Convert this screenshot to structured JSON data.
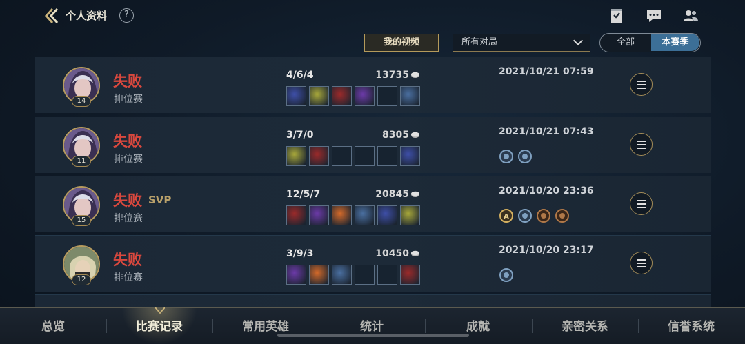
{
  "header": {
    "title": "个人资料",
    "help": "?",
    "icons": [
      "checklist-icon",
      "chat-icon",
      "friends-icon"
    ]
  },
  "filters": {
    "video_button": "我的视频",
    "match_filter": "所有对局",
    "toggle_all": "全部",
    "toggle_season": "本赛季"
  },
  "matches": [
    {
      "level": "14",
      "result": "失败",
      "svp": "",
      "mode": "排位赛",
      "kda": "4/6/4",
      "gold": "13735",
      "date": "2021/10/21 07:59",
      "items": [
        "item",
        "item",
        "item",
        "item",
        "empty",
        "item"
      ],
      "badges": []
    },
    {
      "level": "11",
      "result": "失败",
      "svp": "",
      "mode": "排位赛",
      "kda": "3/7/0",
      "gold": "8305",
      "date": "2021/10/21 07:43",
      "items": [
        "item",
        "item",
        "empty",
        "empty",
        "empty",
        "item"
      ],
      "badges": [
        "badge-blue",
        "badge-blue"
      ]
    },
    {
      "level": "15",
      "result": "失败",
      "svp": "SVP",
      "mode": "排位赛",
      "kda": "12/5/7",
      "gold": "20845",
      "date": "2021/10/20 23:36",
      "items": [
        "item",
        "item",
        "item",
        "item",
        "item",
        "item"
      ],
      "badges": [
        "badge-gold-a",
        "badge-blue",
        "badge-bronze",
        "badge-bronze"
      ]
    },
    {
      "level": "12",
      "result": "失败",
      "svp": "",
      "mode": "排位赛",
      "kda": "3/9/3",
      "gold": "10450",
      "date": "2021/10/20 23:17",
      "items": [
        "item",
        "item",
        "item",
        "empty",
        "empty",
        "item"
      ],
      "badges": [
        "badge-blue"
      ]
    }
  ],
  "tabs": [
    "总览",
    "比赛记录",
    "常用英雄",
    "统计",
    "成就",
    "亲密关系",
    "信誉系统"
  ],
  "active_tab": "比赛记录",
  "colors": {
    "loss": "#d9483e",
    "gold_accent": "#b79b5e",
    "season_toggle": "#3c6f97"
  }
}
